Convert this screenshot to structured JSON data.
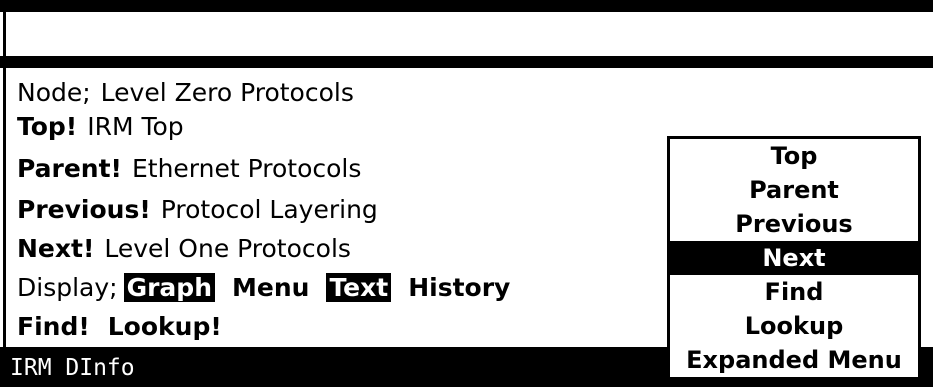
{
  "node": {
    "key": "Node;",
    "value": "Level Zero Protocols"
  },
  "links": [
    {
      "key": "Top!",
      "value": "IRM Top"
    },
    {
      "key": "Parent!",
      "value": "Ethernet Protocols"
    },
    {
      "key": "Previous!",
      "value": "Protocol Layering"
    },
    {
      "key": "Next!",
      "value": "Level One Protocols"
    }
  ],
  "display": {
    "label": "Display;",
    "options": [
      {
        "label": "Graph",
        "selected": true
      },
      {
        "label": "Menu",
        "selected": false
      },
      {
        "label": "Text",
        "selected": true
      },
      {
        "label": "History",
        "selected": false
      }
    ]
  },
  "commands": [
    "Find!",
    "Lookup!"
  ],
  "status": {
    "text": "IRM DInfo"
  },
  "menu": {
    "items": [
      "Top",
      "Parent",
      "Previous",
      "Next",
      "Find",
      "Lookup",
      "Expanded Menu"
    ],
    "highlighted": "Next"
  },
  "colors": {
    "background": "#ffffff",
    "foreground": "#000000"
  }
}
